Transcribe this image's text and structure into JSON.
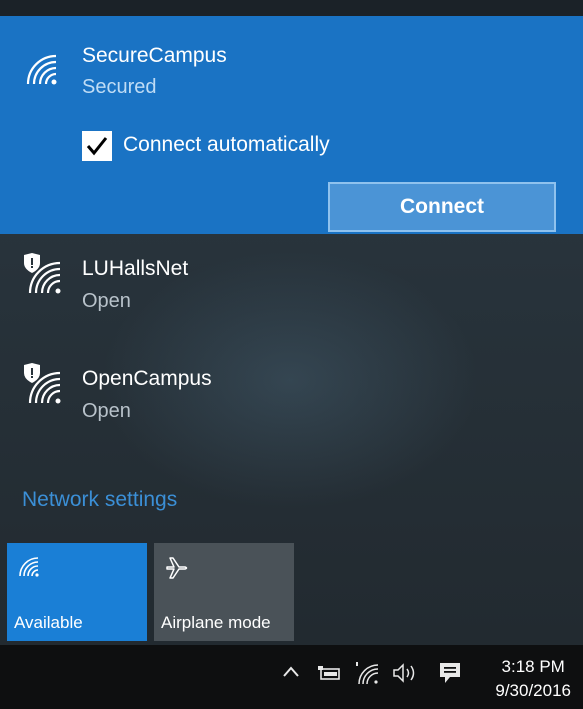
{
  "selected_network": {
    "name": "SecureCampus",
    "status": "Secured",
    "connect_automatically_label": "Connect automatically",
    "connect_automatically_checked": true,
    "connect_button_label": "Connect",
    "icon": "wifi-icon"
  },
  "networks": [
    {
      "name": "LUHallsNet",
      "status": "Open",
      "icon": "wifi-shield-icon"
    },
    {
      "name": "OpenCampus",
      "status": "Open",
      "icon": "wifi-shield-icon"
    }
  ],
  "network_settings_label": "Network settings",
  "quick_actions": [
    {
      "label": "Available",
      "icon": "wifi-icon",
      "active": true
    },
    {
      "label": "Airplane mode",
      "icon": "airplane-icon",
      "active": false
    }
  ],
  "taskbar": {
    "time": "3:18 PM",
    "date": "9/30/2016",
    "icons": [
      "chevron-up-icon",
      "battery-icon",
      "wifi-icon",
      "volume-icon",
      "action-center-icon"
    ]
  },
  "colors": {
    "accent": "#1a73c4",
    "tile_active": "#1a7fd6",
    "link": "#3b8fd6"
  }
}
